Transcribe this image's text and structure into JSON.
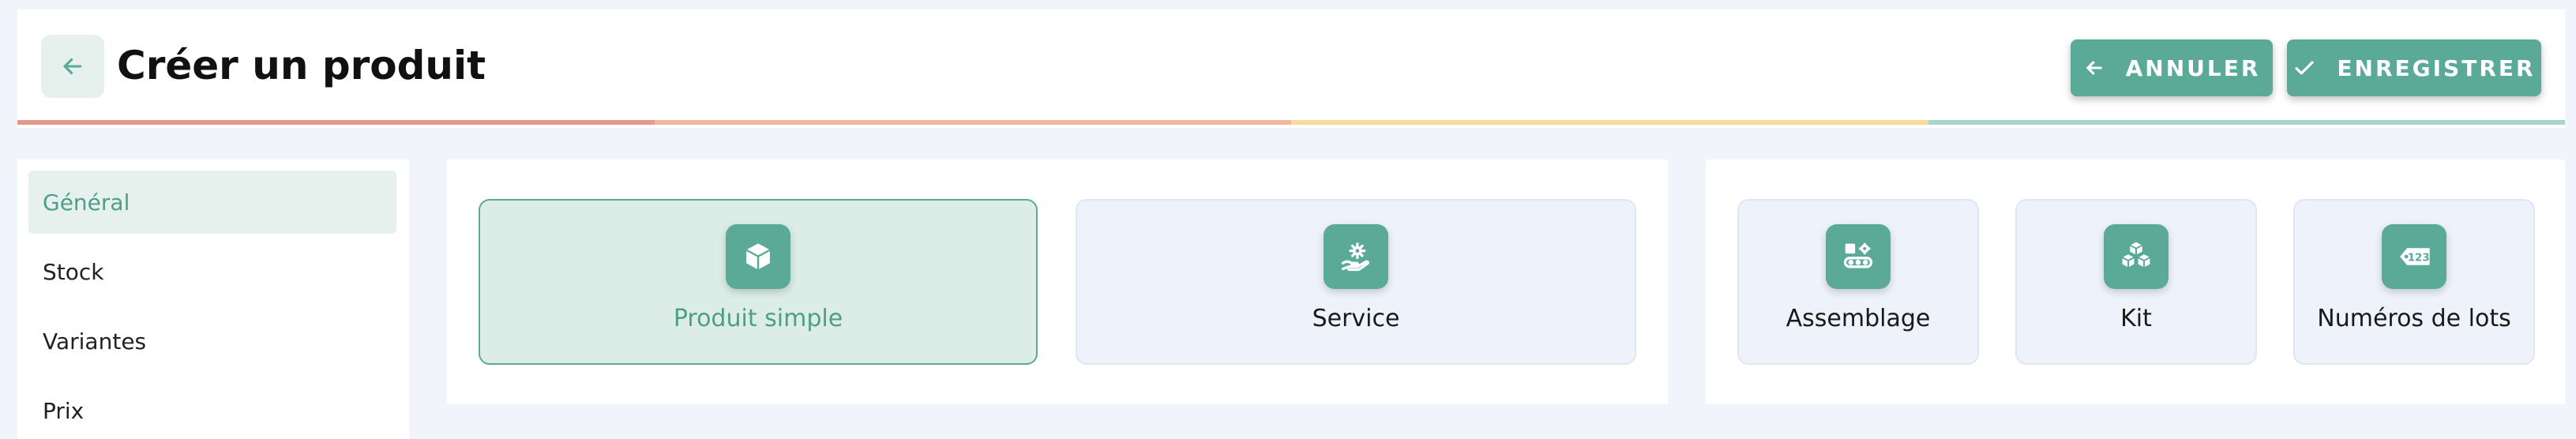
{
  "header": {
    "title": "Créer un produit",
    "cancel_label": "ANNULER",
    "save_label": "ENREGISTRER"
  },
  "progress_colors": [
    "#e49a8f",
    "#f0b89c",
    "#f6dc9a",
    "#a6d7cd"
  ],
  "sidebar": {
    "items": [
      {
        "label": "Général",
        "active": true
      },
      {
        "label": "Stock",
        "active": false
      },
      {
        "label": "Variantes",
        "active": false
      },
      {
        "label": "Prix",
        "active": false
      }
    ]
  },
  "product_types": [
    {
      "label": "Produit simple",
      "icon": "box-icon",
      "selected": true
    },
    {
      "label": "Service",
      "icon": "gear-hand-icon",
      "selected": false
    }
  ],
  "advanced_types": [
    {
      "label": "Assemblage",
      "icon": "assembly-icon",
      "selected": false
    },
    {
      "label": "Kit",
      "icon": "kit-boxes-icon",
      "selected": false
    },
    {
      "label": "Numéros de lots",
      "icon": "lot-tag-icon",
      "selected": false
    }
  ],
  "colors": {
    "accent": "#5aaa97",
    "accent_light": "#e6f1ee",
    "background": "#f1f4fb"
  }
}
